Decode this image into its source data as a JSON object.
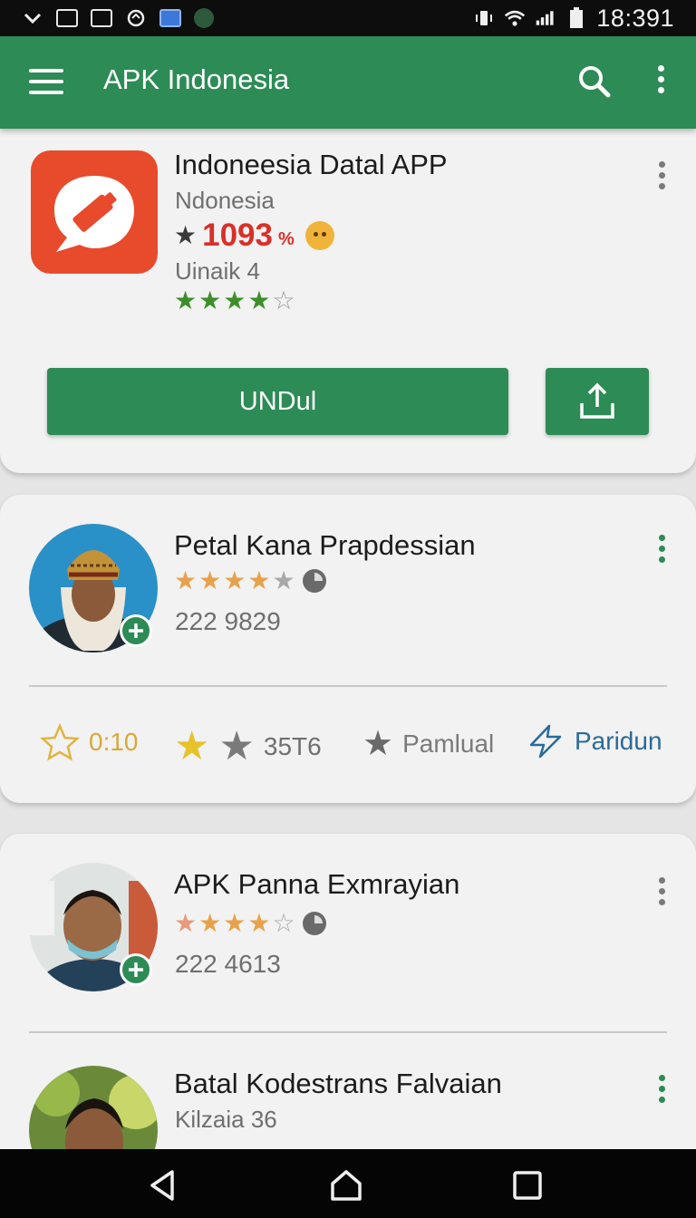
{
  "status_bar": {
    "time": "18:391",
    "left_icons": [
      "chevron-down-icon",
      "keyboard-icon",
      "image-icon",
      "sync-icon",
      "calendar-icon",
      "app-icon"
    ],
    "right_icons": [
      "vibrate-icon",
      "wifi-icon",
      "signal-icon",
      "battery-icon"
    ]
  },
  "app_bar": {
    "title": "APK Indonesia",
    "color": "#2d8b56"
  },
  "featured_app": {
    "title": "Indoneesia Datal APP",
    "subtitle": "Ndonesia",
    "rating_value": "1093",
    "rating_unit": "%",
    "meta": "Uinaik 4",
    "stars": 4,
    "download_label": "UNDul",
    "icon_color": "#e84a2c"
  },
  "cards": [
    {
      "title": "Petal Kana Prapdessian",
      "count": "222 9829",
      "stars": 4,
      "stats": {
        "star_value": "0:10",
        "star_count": "35T6",
        "label_a": "Pamlual",
        "label_b": "Paridun"
      }
    },
    {
      "title": "APK Panna Exmrayian",
      "count": "222 4613",
      "stars": 4
    },
    {
      "title": "Batal Kodestrans Falvaian",
      "subtitle": "Kilzaia 36"
    }
  ],
  "colors": {
    "primary": "#2d8b56",
    "rating_red": "#d9302a",
    "star_green": "#3d8f2a",
    "star_orange": "#e8a14a",
    "link_blue": "#2a6a9a"
  }
}
